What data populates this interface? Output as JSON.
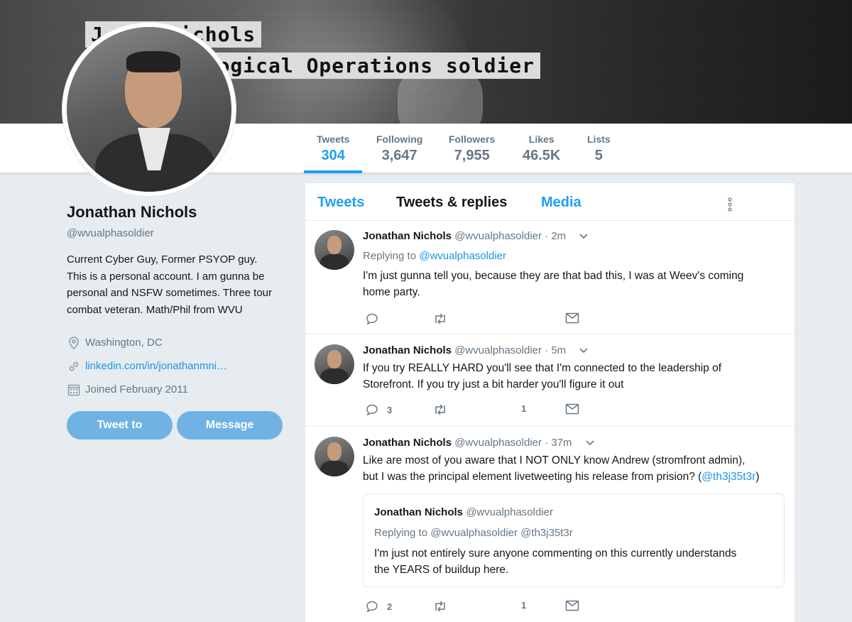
{
  "banner": {
    "caption_line1": "J     Nichols",
    "caption_line2": "      chological Operations soldier"
  },
  "nav": {
    "stats": [
      {
        "label": "Tweets",
        "value": "304",
        "active": true
      },
      {
        "label": "Following",
        "value": "3,647"
      },
      {
        "label": "Followers",
        "value": "7,955"
      },
      {
        "label": "Likes",
        "value": "46.5K"
      },
      {
        "label": "Lists",
        "value": "5"
      }
    ]
  },
  "profile": {
    "name": "Jonathan Nichols",
    "handle": "@wvualphasoldier",
    "bio": "Current Cyber Guy, Former PSYOP guy. This is a personal account. I am gunna be personal and NSFW sometimes. Three tour combat veteran. Math/Phil from WVU",
    "location": "Washington, DC",
    "url": "linkedin.com/in/jonathanmni…",
    "joined": "Joined February 2011",
    "tweet_to_label": "Tweet to",
    "message_label": "Message"
  },
  "timeline": {
    "tabs": [
      "Tweets",
      "Tweets & replies",
      "Media"
    ],
    "tweets": [
      {
        "name": "Jonathan Nichols",
        "handle": "@wvualphasoldier",
        "time": "· 2m",
        "replying_prefix": "Replying to ",
        "replying_to": "@wvualphasoldier",
        "text_line1": "I'm just gunna tell you, because they are that bad this, I was at Weev's coming",
        "text_line2": "home party.",
        "replies": "",
        "likes": ""
      },
      {
        "name": "Jonathan Nichols",
        "handle": "@wvualphasoldier",
        "time": "· 5m",
        "text_line1": "If you try REALLY HARD you'll see that I'm connected to the leadership of",
        "text_line2": "Storefront. If you try just a bit harder you'll figure it out",
        "replies": "3",
        "likes": "1"
      },
      {
        "name": "Jonathan Nichols",
        "handle": "@wvualphasoldier",
        "time": "· 37m",
        "text_line1": "Like are most of you aware that I NOT ONLY know Andrew (stromfront admin),",
        "text_line2": "but I was the principal element livetweeting his release from prision? (",
        "text_link": "@th3j35t3r",
        "text_end": ")",
        "quote": {
          "name": "Jonathan Nichols",
          "handle": "@wvualphasoldier",
          "replying": "Replying to @wvualphasoldier @th3j35t3r",
          "text_line1": "I'm just not entirely sure anyone commenting on this currently understands",
          "text_line2": "the YEARS of buildup here."
        },
        "replies": "2",
        "likes": "1"
      }
    ]
  },
  "colors": {
    "accent": "#1da1f2",
    "button": "#71b2e4",
    "muted": "#657786",
    "link": "#1b95e0"
  }
}
